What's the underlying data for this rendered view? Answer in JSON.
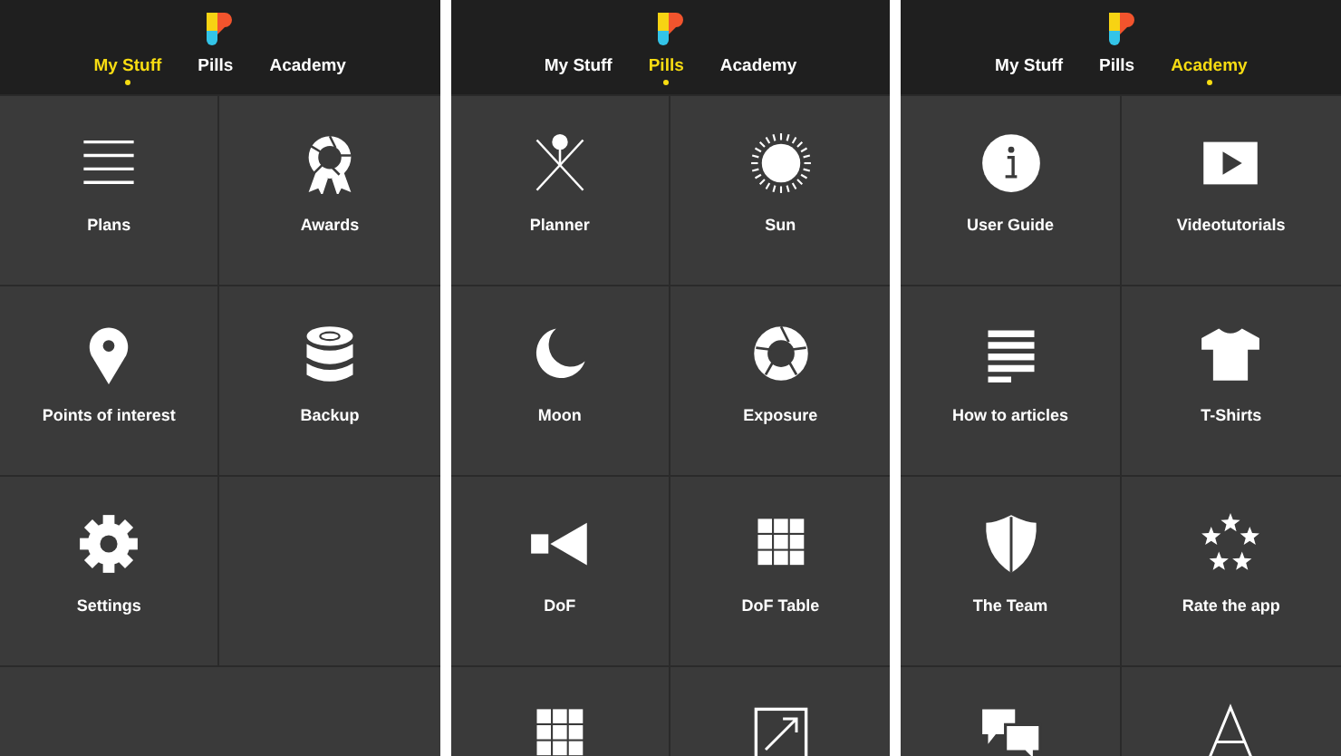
{
  "screens": [
    {
      "tabs": [
        {
          "label": "My Stuff",
          "selected": true
        },
        {
          "label": "Pills",
          "selected": false
        },
        {
          "label": "Academy",
          "selected": false
        }
      ],
      "tiles": [
        {
          "kind": "plans",
          "label": "Plans"
        },
        {
          "kind": "awards",
          "label": "Awards"
        },
        {
          "kind": "pin",
          "label": "Points of interest"
        },
        {
          "kind": "backup",
          "label": "Backup"
        },
        {
          "kind": "settings",
          "label": "Settings"
        }
      ]
    },
    {
      "tabs": [
        {
          "label": "My Stuff",
          "selected": false
        },
        {
          "label": "Pills",
          "selected": true
        },
        {
          "label": "Academy",
          "selected": false
        }
      ],
      "tiles": [
        {
          "kind": "planner",
          "label": "Planner"
        },
        {
          "kind": "sun",
          "label": "Sun"
        },
        {
          "kind": "moon",
          "label": "Moon"
        },
        {
          "kind": "exposure",
          "label": "Exposure"
        },
        {
          "kind": "dof",
          "label": "DoF"
        },
        {
          "kind": "grid",
          "label": "DoF Table"
        },
        {
          "kind": "grid"
        },
        {
          "kind": "resize"
        }
      ]
    },
    {
      "tabs": [
        {
          "label": "My Stuff",
          "selected": false
        },
        {
          "label": "Pills",
          "selected": false
        },
        {
          "label": "Academy",
          "selected": true
        }
      ],
      "tiles": [
        {
          "kind": "info",
          "label": "User Guide"
        },
        {
          "kind": "video",
          "label": "Videotutorials"
        },
        {
          "kind": "article",
          "label": "How to articles"
        },
        {
          "kind": "shirt",
          "label": "T-Shirts"
        },
        {
          "kind": "shield",
          "label": "The Team"
        },
        {
          "kind": "stars",
          "label": "Rate the app"
        },
        {
          "kind": "chat"
        },
        {
          "kind": "aframe"
        }
      ]
    }
  ]
}
